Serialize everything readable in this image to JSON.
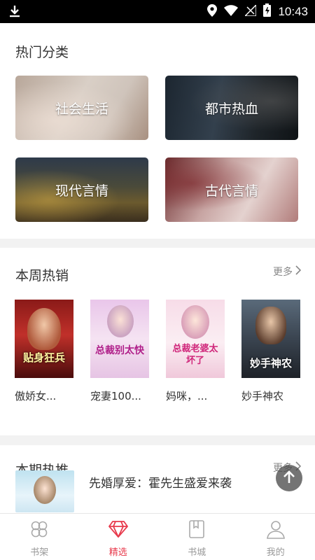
{
  "status": {
    "time": "10:43"
  },
  "categories": {
    "title": "热门分类",
    "items": [
      {
        "label": "社会生活"
      },
      {
        "label": "都市热血"
      },
      {
        "label": "现代言情"
      },
      {
        "label": "古代言情"
      }
    ]
  },
  "weekly": {
    "title": "本周热销",
    "more": "更多",
    "books": [
      {
        "title": "傲娇女...",
        "cover_text": "贴身狂兵"
      },
      {
        "title": "宠妻100...",
        "cover_text": "总裁别太快"
      },
      {
        "title": "妈咪，...",
        "cover_text": "总裁老婆太坏了"
      },
      {
        "title": "妙手神农",
        "cover_text": "妙手神农"
      }
    ]
  },
  "recommend": {
    "title": "本期热推",
    "more": "更多",
    "item_title": "先婚厚爱：霍先生盛爱来袭"
  },
  "tabs": [
    {
      "label": "书架",
      "icon": "bookshelf-icon"
    },
    {
      "label": "精选",
      "icon": "diamond-icon",
      "active": true
    },
    {
      "label": "书城",
      "icon": "bookstore-icon"
    },
    {
      "label": "我的",
      "icon": "profile-icon"
    }
  ],
  "colors": {
    "accent": "#e83a4c",
    "inactive": "#999999"
  }
}
